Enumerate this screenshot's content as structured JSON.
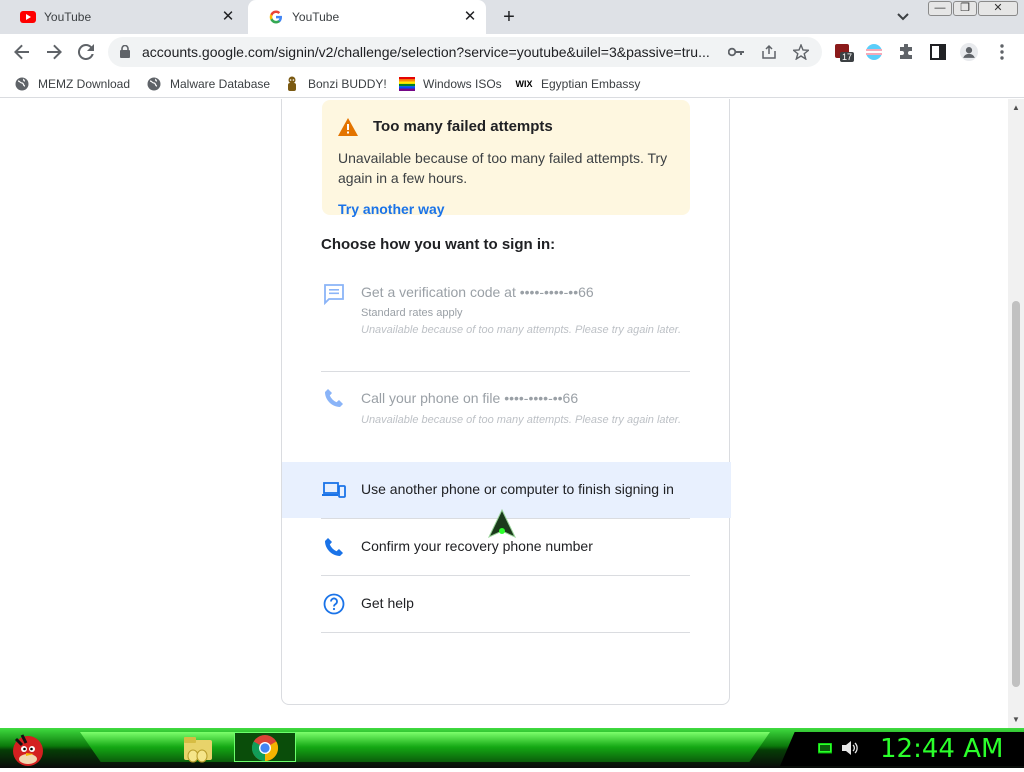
{
  "browser": {
    "tabs": [
      {
        "title": "YouTube",
        "active": false
      },
      {
        "title": "YouTube",
        "active": true
      }
    ],
    "url": "accounts.google.com/signin/v2/challenge/selection?service=youtube&uilel=3&passive=tru...",
    "extension_badge": "17",
    "bookmarks": [
      {
        "label": "MEMZ Download",
        "icon": "globe-icon"
      },
      {
        "label": "Malware Database",
        "icon": "globe-icon"
      },
      {
        "label": "Bonzi BUDDY!",
        "icon": "bonzi-icon"
      },
      {
        "label": "Windows ISOs",
        "icon": "rainbow-icon"
      },
      {
        "label": "Egyptian Embassy",
        "icon": "wix-icon"
      }
    ]
  },
  "page": {
    "warning": {
      "title": "Too many failed attempts",
      "body": "Unavailable because of too many failed attempts. Try again in a few hours.",
      "link": "Try another way"
    },
    "choose_heading": "Choose how you want to sign in:",
    "options": [
      {
        "title": "Get a verification code at ••••-••••-••66",
        "subtitle": "Standard rates apply",
        "note": "Unavailable because of too many attempts. Please try again later.",
        "disabled": true,
        "icon": "message-icon"
      },
      {
        "title": "Call your phone on file ••••-••••-••66",
        "subtitle": "",
        "note": "Unavailable because of too many attempts. Please try again later.",
        "disabled": true,
        "icon": "phone-icon"
      },
      {
        "title": "Use another phone or computer to finish signing in",
        "disabled": false,
        "icon": "devices-icon",
        "hovered": true
      },
      {
        "title": "Confirm your recovery phone number",
        "disabled": false,
        "icon": "phone-icon"
      },
      {
        "title": "Get help",
        "disabled": false,
        "icon": "help-icon"
      }
    ]
  },
  "taskbar": {
    "clock": "12:44 AM"
  },
  "colors": {
    "accent": "#1a73e8",
    "warning_bg": "#fef7e0",
    "hover_bg": "#e8f0fe",
    "taskbar_green": "#14a814",
    "clock": "#2bff2b"
  }
}
